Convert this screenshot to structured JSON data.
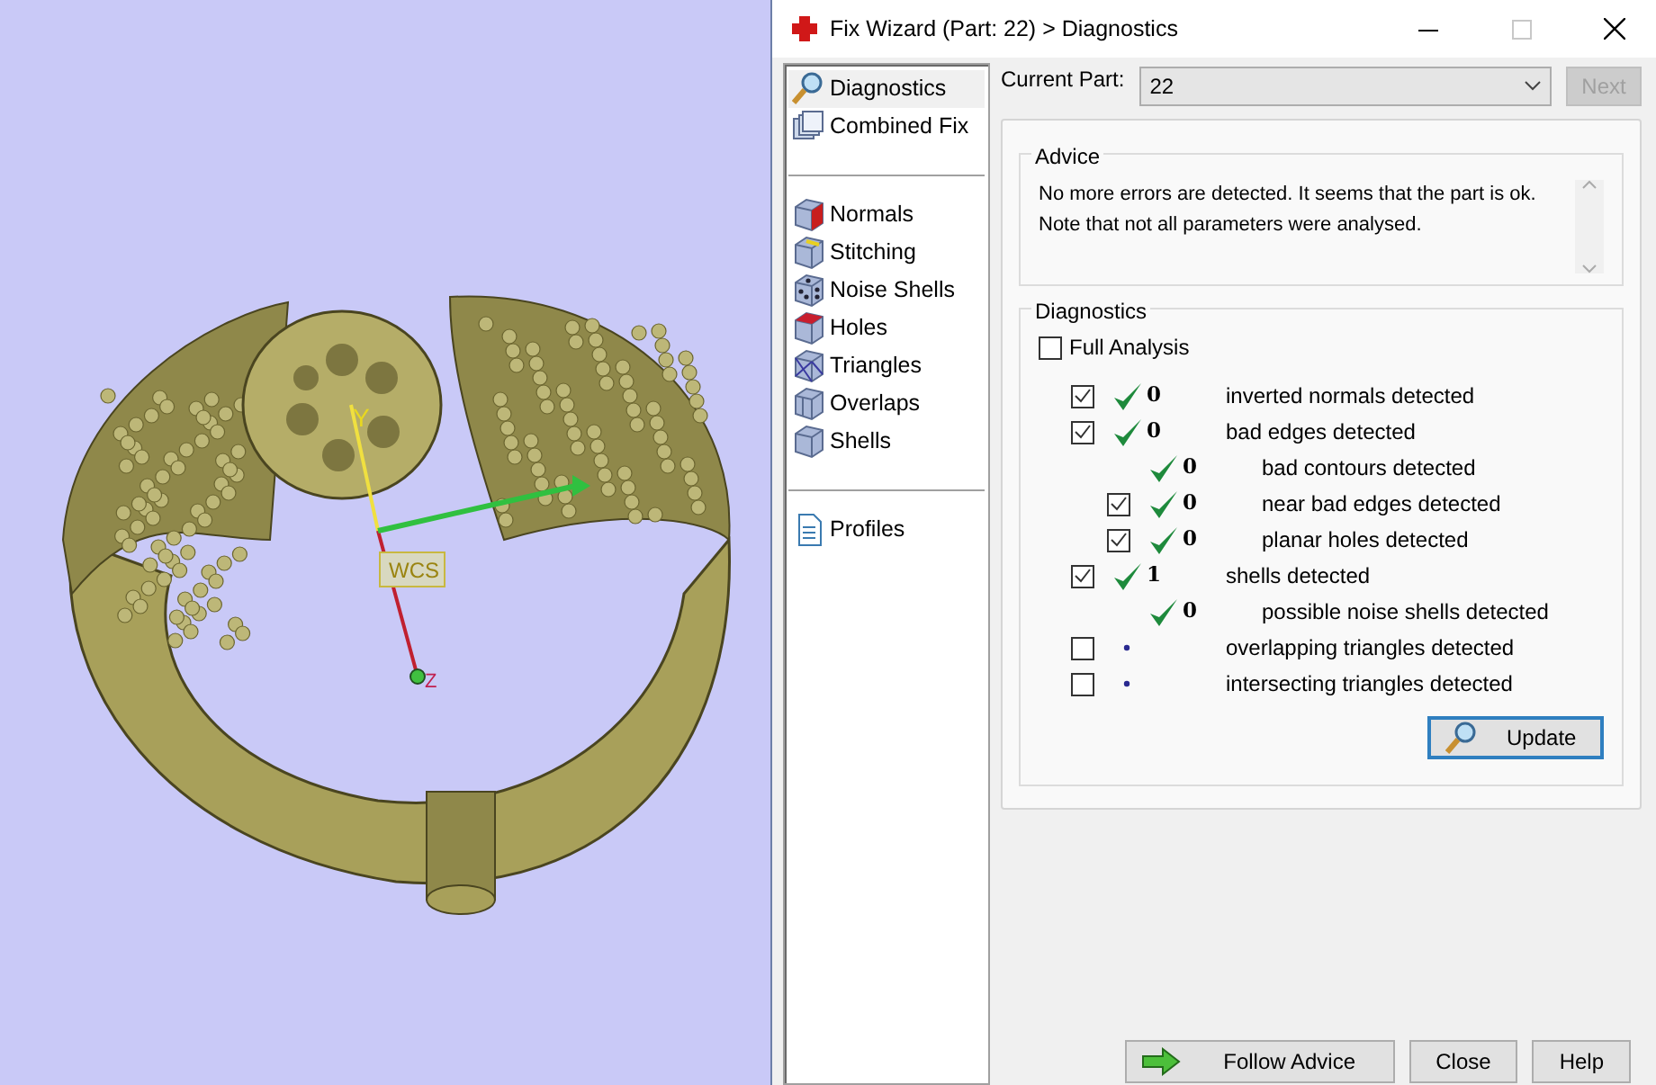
{
  "viewport": {
    "axis_labels": [
      {
        "kind": "y",
        "text": "Y"
      },
      {
        "kind": "z",
        "text": "Z"
      },
      {
        "kind": "wcs",
        "text": "WCS"
      }
    ]
  },
  "window": {
    "title": "Fix Wizard (Part: 22) > Diagnostics",
    "maximize_disabled": true
  },
  "sidebar": {
    "groups": [
      {
        "items": [
          {
            "label": "Diagnostics",
            "selected": true
          },
          {
            "label": "Combined Fix",
            "selected": false
          }
        ]
      },
      {
        "items": [
          {
            "label": "Normals",
            "selected": false
          },
          {
            "label": "Stitching",
            "selected": false
          },
          {
            "label": "Noise Shells",
            "selected": false
          },
          {
            "label": "Holes",
            "selected": false
          },
          {
            "label": "Triangles",
            "selected": false
          },
          {
            "label": "Overlaps",
            "selected": false
          },
          {
            "label": "Shells",
            "selected": false
          }
        ]
      },
      {
        "items": [
          {
            "label": "Profiles",
            "selected": false
          }
        ]
      }
    ]
  },
  "current_part": {
    "label": "Current Part:",
    "value": "22",
    "next": {
      "label": "Next",
      "disabled": true
    }
  },
  "advice": {
    "title": "Advice",
    "lines": [
      "No more errors are detected. It seems that the part is ok.",
      "Note that not all parameters were analysed."
    ]
  },
  "diagnostics": {
    "title": "Diagnostics",
    "full_analysis": {
      "label": "Full Analysis",
      "checked": false
    },
    "rows": [
      {
        "kind": "checkbox",
        "checked": true,
        "passed": true,
        "count": "0",
        "label": "inverted normals detected"
      },
      {
        "kind": "checkbox",
        "checked": true,
        "passed": true,
        "count": "0",
        "label": "bad edges detected",
        "children": [
          {
            "kind": "plain",
            "passed": true,
            "count": "0",
            "label": "bad contours detected"
          },
          {
            "kind": "checkbox",
            "checked": true,
            "passed": true,
            "count": "0",
            "label": "near bad edges detected"
          },
          {
            "kind": "checkbox",
            "checked": true,
            "passed": true,
            "count": "0",
            "label": "planar holes detected"
          }
        ]
      },
      {
        "kind": "checkbox",
        "checked": true,
        "passed": true,
        "count": "1",
        "label": "shells detected",
        "children": [
          {
            "kind": "plain",
            "passed": true,
            "count": "0",
            "label": "possible noise shells detected"
          }
        ]
      },
      {
        "kind": "checkbox",
        "checked": false,
        "passed": false,
        "label": "overlapping triangles detected"
      },
      {
        "kind": "checkbox",
        "checked": false,
        "passed": false,
        "label": "intersecting triangles detected"
      }
    ],
    "update": {
      "label": "Update"
    }
  },
  "buttons": [
    {
      "kind": "follow",
      "label": "Follow Advice"
    },
    {
      "kind": "plain",
      "label": "Close"
    },
    {
      "kind": "plain",
      "label": "Help"
    }
  ]
}
